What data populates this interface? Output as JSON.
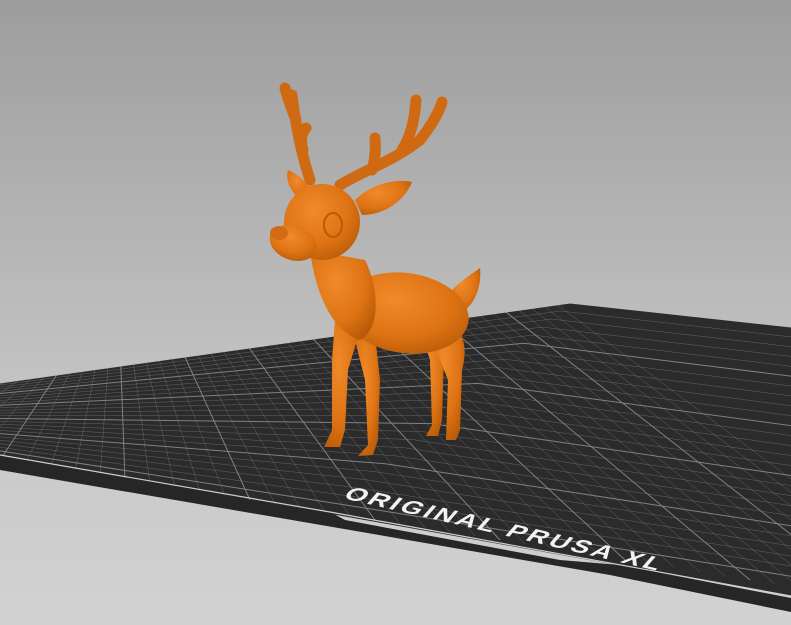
{
  "viewport": {
    "bed_label": "ORIGINAL PRUSA XL",
    "model_color": "#e0761a",
    "bed_color": "#2b2b2b",
    "grid_color": "#8a8a8a",
    "model_name": "deer"
  }
}
